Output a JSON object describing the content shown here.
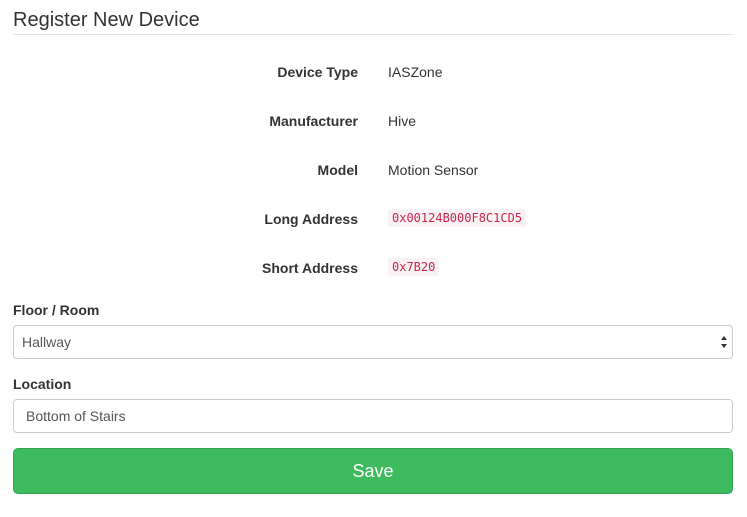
{
  "page": {
    "title": "Register New Device"
  },
  "device_info": [
    {
      "label": "Device Type",
      "value": "IASZone"
    },
    {
      "label": "Manufacturer",
      "value": "Hive"
    },
    {
      "label": "Model",
      "value": "Motion Sensor"
    },
    {
      "label": "Long Address",
      "value": "0x00124B000F8C1CD5"
    },
    {
      "label": "Short Address",
      "value": "0x7B20"
    }
  ],
  "form": {
    "floor_room": {
      "label": "Floor / Room",
      "selected": "Hallway"
    },
    "location": {
      "label": "Location",
      "value": "Bottom of Stairs"
    },
    "save_label": "Save"
  },
  "colors": {
    "save_button": "#3dbb5e",
    "code_text": "#c7254e",
    "code_background": "#f9f2f4"
  },
  "icons": {
    "select_arrow": "up-down-chevron-icon"
  }
}
